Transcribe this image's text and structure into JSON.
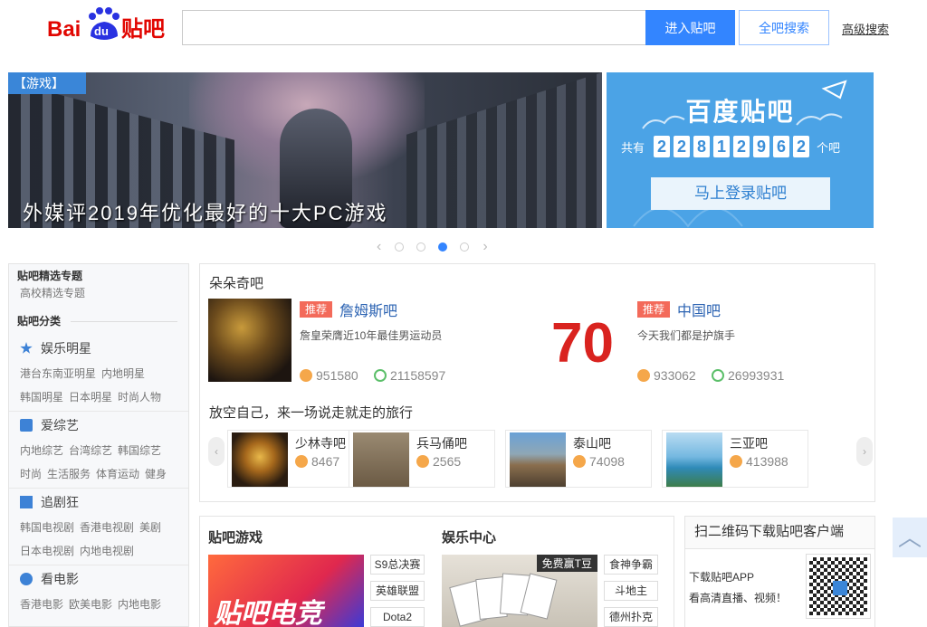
{
  "header": {
    "logo_text_bai": "Bai",
    "logo_text_du": "du",
    "logo_text_tieba": "贴吧",
    "search_placeholder": "",
    "enter_button": "进入贴吧",
    "search_all_button": "全吧搜索",
    "advanced_search": "高级搜索"
  },
  "banner": {
    "tag": "【游戏】",
    "caption": "外媒评2019年优化最好的十大PC游戏",
    "slides": 4,
    "active_slide": 3
  },
  "side_card": {
    "title": "百度贴吧",
    "prefix": "共有",
    "digits": [
      "2",
      "2",
      "8",
      "1",
      "2",
      "9",
      "6",
      "2"
    ],
    "suffix": "个吧",
    "login_button": "马上登录贴吧"
  },
  "sidebar": {
    "featured_heading": "贴吧精选专题",
    "featured_link": "高校精选专题",
    "category_heading": "贴吧分类",
    "groups": [
      {
        "title": "娱乐明星",
        "icon": "star-icon",
        "rows": [
          [
            "港台东南亚明星",
            "内地明星"
          ],
          [
            "韩国明星",
            "日本明星",
            "时尚人物"
          ]
        ]
      },
      {
        "title": "爱综艺",
        "icon": "tv-icon",
        "rows": [
          [
            "内地综艺",
            "台湾综艺",
            "韩国综艺"
          ],
          [
            "时尚",
            "生活服务",
            "体育运动",
            "健身"
          ]
        ]
      },
      {
        "title": "追剧狂",
        "icon": "film-icon",
        "rows": [
          [
            "韩国电视剧",
            "香港电视剧",
            "美剧"
          ],
          [
            "日本电视剧",
            "内地电视剧"
          ]
        ]
      },
      {
        "title": "看电影",
        "icon": "movie-icon",
        "rows": [
          [
            "香港电影",
            "欧美电影",
            "内地电影"
          ]
        ]
      }
    ]
  },
  "duoduoqi": {
    "title": "朵朵奇吧",
    "items": [
      {
        "badge": "推荐",
        "name": "詹姆斯吧",
        "desc": "詹皇荣膺近10年最佳男运动员",
        "members": "951580",
        "posts": "21158597"
      },
      {
        "badge": "推荐",
        "name": "中国吧",
        "desc": "今天我们都是护旗手",
        "members": "933062",
        "posts": "26993931"
      }
    ]
  },
  "travel": {
    "title": "放空自己，来一场说走就走的旅行",
    "items": [
      {
        "name": "少林寺吧",
        "count": "8467"
      },
      {
        "name": "兵马俑吧",
        "count": "2565"
      },
      {
        "name": "泰山吧",
        "count": "74098"
      },
      {
        "name": "三亚吧",
        "count": "413988"
      }
    ]
  },
  "games": {
    "title": "贴吧游戏",
    "banner_text": "贴吧电竞",
    "buttons": [
      "S9总决赛",
      "英雄联盟",
      "Dota2"
    ]
  },
  "entertainment": {
    "title": "娱乐中心",
    "promo": "免费赢T豆",
    "buttons": [
      "食神争霸",
      "斗地主",
      "德州扑克"
    ]
  },
  "app_download": {
    "title": "扫二维码下载贴吧客户端",
    "line1": "下载贴吧APP",
    "line2": "看高清直播、视频！"
  },
  "colors": {
    "brand_red": "#e10601",
    "brand_blue": "#2932e1",
    "accent": "#3385ff"
  }
}
